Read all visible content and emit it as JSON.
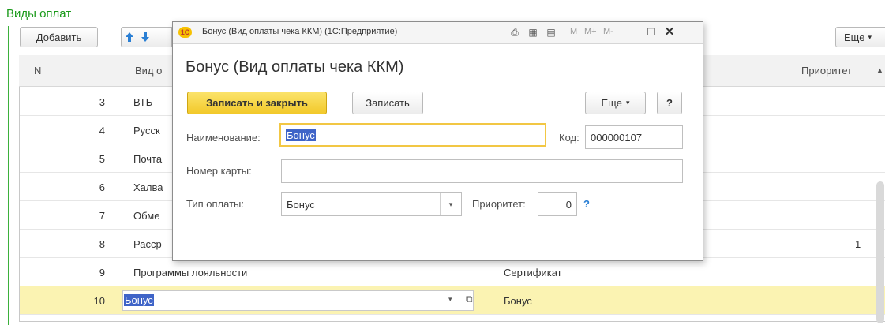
{
  "page": {
    "section_title": "Виды оплат"
  },
  "toolbar": {
    "add_label": "Добавить",
    "more_label": "Еще",
    "up_icon": "arrow-up-icon",
    "down_icon": "arrow-down-icon"
  },
  "table": {
    "columns": [
      "N",
      "Вид о",
      "Приоритет"
    ],
    "rows": [
      {
        "n": "3",
        "name": "ВТБ",
        "type": "",
        "priority": ""
      },
      {
        "n": "4",
        "name": "Русск",
        "type": "",
        "priority": ""
      },
      {
        "n": "5",
        "name": "Почта",
        "type": "",
        "priority": ""
      },
      {
        "n": "6",
        "name": "Халва",
        "type": "",
        "priority": ""
      },
      {
        "n": "7",
        "name": "Обме",
        "type": "",
        "priority": ""
      },
      {
        "n": "8",
        "name": "Расср",
        "type": "",
        "priority": "1"
      },
      {
        "n": "9",
        "name": "Программы лояльности",
        "type": "Сертификат",
        "priority": ""
      },
      {
        "n": "10",
        "name": "Бонус",
        "type": "Бонус",
        "priority": ""
      }
    ]
  },
  "dialog": {
    "window_title": "Бонус (Вид оплаты чека ККМ)  (1С:Предприятие)",
    "logo_text": "1С",
    "memory_buttons": [
      "M",
      "M+",
      "M-"
    ],
    "form_title": "Бонус (Вид оплаты чека ККМ)",
    "save_close_label": "Записать и закрыть",
    "save_label": "Записать",
    "more_label": "Еще",
    "help_label": "?",
    "name_label": "Наименование:",
    "name_value": "Бонус",
    "code_label": "Код:",
    "code_value": "000000107",
    "card_label": "Номер карты:",
    "card_value": "",
    "pay_type_label": "Тип оплаты:",
    "pay_type_value": "Бонус",
    "priority_label": "Приоритет:",
    "priority_value": "0",
    "priority_help": "?"
  },
  "colors": {
    "accent_green": "#1a9a1a",
    "primary_button": "#f7d43a",
    "selection": "#3f64c8",
    "selected_row": "#fbf3b2"
  }
}
